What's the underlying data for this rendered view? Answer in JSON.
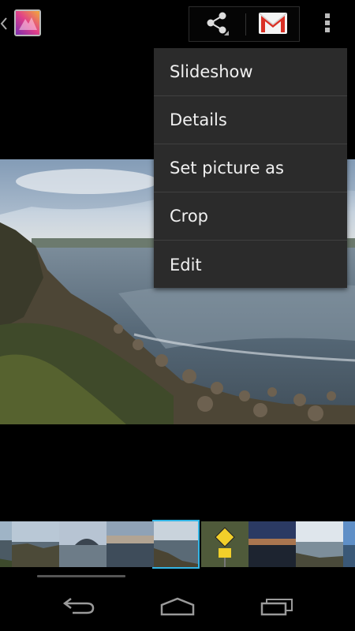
{
  "actionbar": {
    "up_icon": "chevron-left-icon",
    "app_icon": "gallery-icon",
    "share_icon": "share-icon",
    "gmail_icon": "gmail-icon",
    "overflow_icon": "overflow-menu-icon"
  },
  "menu": {
    "items": [
      {
        "label": "Slideshow"
      },
      {
        "label": "Details"
      },
      {
        "label": "Set picture as"
      },
      {
        "label": "Crop"
      },
      {
        "label": "Edit"
      }
    ]
  },
  "filmstrip": {
    "thumb_count": 8,
    "selected_index": 3
  },
  "navbar": {
    "back_icon": "back-icon",
    "home_icon": "home-icon",
    "recents_icon": "recent-apps-icon"
  },
  "colors": {
    "accent": "#33b5e5",
    "menu_bg": "#2b2b2b",
    "menu_divider": "#404040",
    "background": "#000000"
  }
}
